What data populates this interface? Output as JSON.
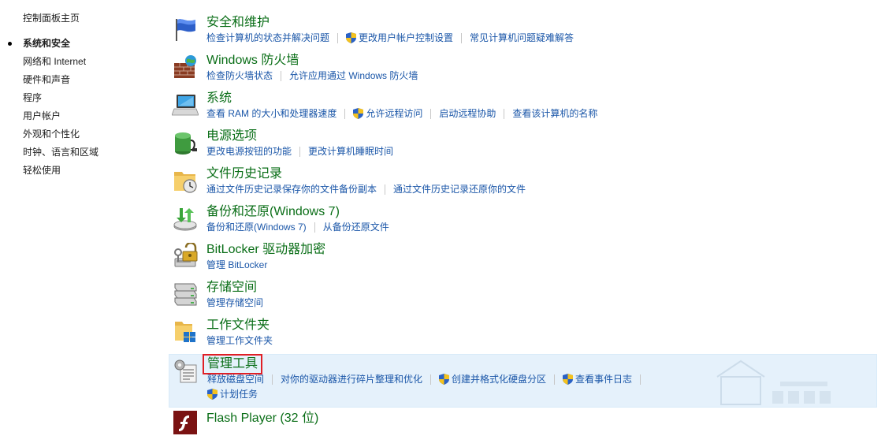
{
  "sidebar": {
    "home": "控制面板主页",
    "items": [
      {
        "label": "系统和安全",
        "active": true
      },
      {
        "label": "网络和 Internet"
      },
      {
        "label": "硬件和声音"
      },
      {
        "label": "程序"
      },
      {
        "label": "用户帐户"
      },
      {
        "label": "外观和个性化"
      },
      {
        "label": "时钟、语言和区域"
      },
      {
        "label": "轻松使用"
      }
    ]
  },
  "categories": [
    {
      "title": "安全和维护",
      "icon": "flag-icon",
      "links": [
        {
          "label": "检查计算机的状态并解决问题"
        },
        {
          "label": "更改用户帐户控制设置",
          "shield": true
        },
        {
          "label": "常见计算机问题疑难解答"
        }
      ]
    },
    {
      "title": "Windows 防火墙",
      "icon": "firewall-icon",
      "links": [
        {
          "label": "检查防火墙状态"
        },
        {
          "label": "允许应用通过 Windows 防火墙"
        }
      ]
    },
    {
      "title": "系统",
      "icon": "computer-icon",
      "links": [
        {
          "label": "查看 RAM 的大小和处理器速度"
        },
        {
          "label": "允许远程访问",
          "shield": true
        },
        {
          "label": "启动远程协助"
        },
        {
          "label": "查看该计算机的名称"
        }
      ]
    },
    {
      "title": "电源选项",
      "icon": "battery-icon",
      "links": [
        {
          "label": "更改电源按钮的功能"
        },
        {
          "label": "更改计算机睡眠时间"
        }
      ]
    },
    {
      "title": "文件历史记录",
      "icon": "file-history-icon",
      "links": [
        {
          "label": "通过文件历史记录保存你的文件备份副本"
        },
        {
          "label": "通过文件历史记录还原你的文件"
        }
      ]
    },
    {
      "title": "备份和还原(Windows 7)",
      "icon": "backup-icon",
      "links": [
        {
          "label": "备份和还原(Windows 7)"
        },
        {
          "label": "从备份还原文件"
        }
      ]
    },
    {
      "title": "BitLocker 驱动器加密",
      "icon": "bitlocker-icon",
      "links": [
        {
          "label": "管理 BitLocker"
        }
      ]
    },
    {
      "title": "存储空间",
      "icon": "storage-icon",
      "links": [
        {
          "label": "管理存储空间"
        }
      ]
    },
    {
      "title": "工作文件夹",
      "icon": "work-folders-icon",
      "links": [
        {
          "label": "管理工作文件夹"
        }
      ]
    },
    {
      "title": "管理工具",
      "icon": "admin-tools-icon",
      "highlighted": true,
      "links": [
        {
          "label": "释放磁盘空间"
        },
        {
          "label": "对你的驱动器进行碎片整理和优化"
        },
        {
          "label": "创建并格式化硬盘分区",
          "shield": true
        },
        {
          "label": "查看事件日志",
          "shield": true
        }
      ],
      "links2": [
        {
          "label": "计划任务",
          "shield": true
        }
      ]
    },
    {
      "title": "Flash Player (32 位)",
      "icon": "flash-player-icon",
      "links": []
    }
  ],
  "colors": {
    "link": "#1a56a8",
    "title": "#0a6e17",
    "highlight_bg": "#e5f1fb",
    "box": "#e01f26"
  }
}
